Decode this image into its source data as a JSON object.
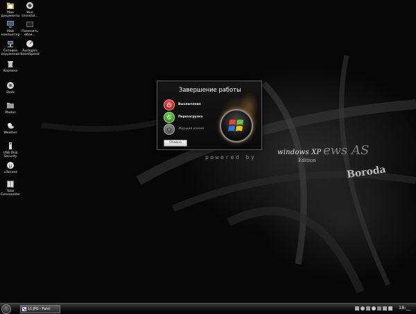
{
  "desktop": {
    "icons": [
      {
        "label": "Мои документы",
        "icon": "folder-documents-icon"
      },
      {
        "label": "Your Uninstal...",
        "icon": "uninstaller-icon"
      },
      {
        "label": "Мой компьютер",
        "icon": "computer-icon"
      },
      {
        "label": "Поменять обои...",
        "icon": "wallpaper-icon"
      },
      {
        "label": "Сетевое окружение",
        "icon": "network-icon"
      },
      {
        "label": "Auslogics BoostSpeed",
        "icon": "boostspeed-icon"
      },
      {
        "label": "Корзина",
        "icon": "recycle-bin-icon"
      },
      {
        "label": "Dock",
        "icon": "dock-icon"
      },
      {
        "label": "Photos",
        "icon": "photos-icon"
      },
      {
        "label": "Weather",
        "icon": "weather-icon"
      },
      {
        "label": "USB Disk Security",
        "icon": "usb-security-icon"
      },
      {
        "label": "uTorrent",
        "icon": "utorrent-icon"
      },
      {
        "label": "Total Commander",
        "icon": "total-commander-icon"
      }
    ]
  },
  "wallpaper": {
    "brand": "windows XP",
    "edition": "Edition",
    "series": "ews AS",
    "tagline": "powered by",
    "graffiti": "Boroda"
  },
  "dialog": {
    "title": "Завершение работы",
    "options": [
      {
        "label": "Выключение",
        "icon": "power-off-icon",
        "color": "#d42020"
      },
      {
        "label": "Перезагрузка",
        "icon": "restart-icon",
        "color": "#3aa02a"
      },
      {
        "label": "Ждущий режим",
        "icon": "standby-icon",
        "color": "#8a8a8a"
      }
    ],
    "cancel_label": "Отмена"
  },
  "taskbar": {
    "active_window": "11.JPG - Paint",
    "clock": "18:__"
  },
  "colors": {
    "background": "#050505",
    "taskbar": "#1e1e1e"
  }
}
